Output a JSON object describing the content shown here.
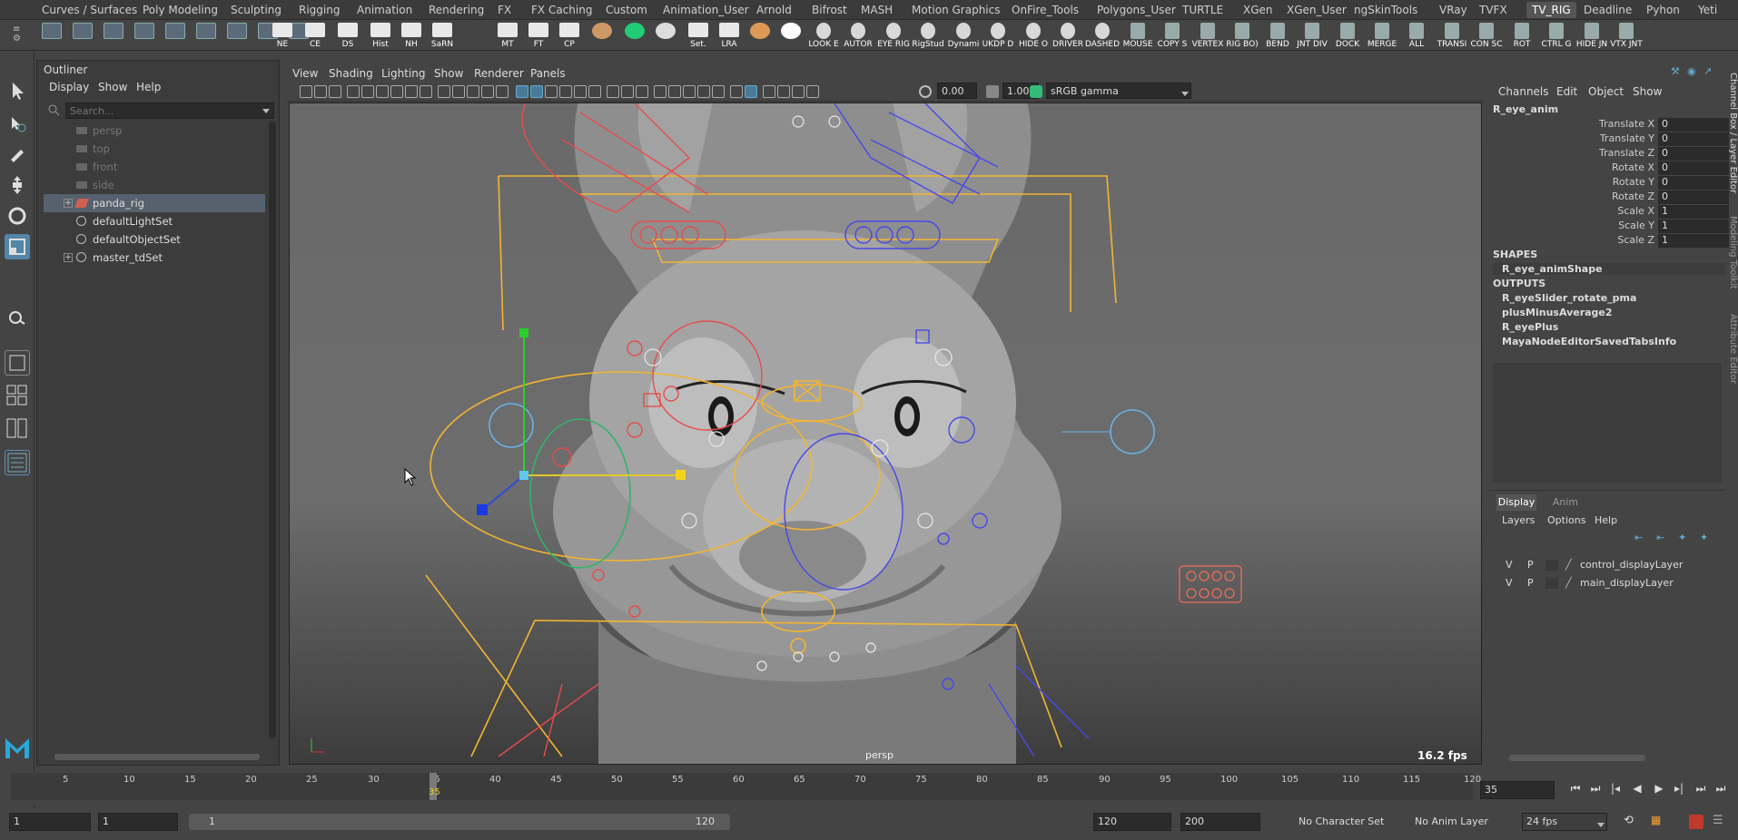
{
  "shelf_tabs": [
    "Curves / Surfaces",
    "Poly Modeling",
    "Sculpting",
    "Rigging",
    "Animation",
    "Rendering",
    "FX",
    "FX Caching",
    "Custom",
    "Animation_User",
    "Arnold",
    "Bifrost",
    "MASH",
    "Motion Graphics",
    "OnFire_Tools",
    "Polygons_User",
    "TURTLE",
    "XGen",
    "XGen_User",
    "ngSkinTools",
    "VRay",
    "TVFX",
    "TV_RIG",
    "Deadline",
    "Pyhon",
    "Yeti"
  ],
  "active_shelf_tab": "TV_RIG",
  "shelf_labels_left": [
    "NE",
    "CE",
    "DS",
    "Hist",
    "NH",
    "SaRN",
    "MT",
    "FT",
    "CP",
    "Set.",
    "LRA"
  ],
  "shelf_labels_right": [
    "LOOK E",
    "AUTOR",
    "EYE RIG",
    "RigStud",
    "Dynami",
    "UKDP D",
    "HIDE O",
    "DRIVER",
    "DASHED",
    "MOUSE",
    "COPY S",
    "VERTEX",
    "RIG BO)",
    "BEND",
    "JNT DIV",
    "DOCK",
    "MERGE",
    "ALL",
    "TRANSI",
    "CON SC",
    "ROT",
    "CTRL G",
    "HIDE JN",
    "VTX JNT"
  ],
  "outliner": {
    "title": "Outliner",
    "menu": [
      "Display",
      "Show",
      "Help"
    ],
    "search_placeholder": "Search...",
    "items": [
      {
        "name": "persp",
        "dim": true,
        "icon": "camera-icon"
      },
      {
        "name": "top",
        "dim": true,
        "icon": "camera-icon"
      },
      {
        "name": "front",
        "dim": true,
        "icon": "camera-icon"
      },
      {
        "name": "side",
        "dim": true,
        "icon": "camera-icon"
      },
      {
        "name": "panda_rig",
        "dim": false,
        "icon": "group-icon",
        "selected": true,
        "expandable": true
      },
      {
        "name": "defaultLightSet",
        "dim": false,
        "icon": "set-icon"
      },
      {
        "name": "defaultObjectSet",
        "dim": false,
        "icon": "set-icon"
      },
      {
        "name": "master_tdSet",
        "dim": false,
        "icon": "set-icon",
        "expandable": true
      }
    ]
  },
  "viewport": {
    "menu": [
      "View",
      "Shading",
      "Lighting",
      "Show",
      "Renderer",
      "Panels"
    ],
    "exposure": "0.00",
    "gamma": "1.00",
    "colorspace": "sRGB gamma",
    "camera_label": "persp",
    "fps": "16.2 fps"
  },
  "channel_box": {
    "menu": [
      "Channels",
      "Edit",
      "Object",
      "Show"
    ],
    "node": "R_eye_anim",
    "attrs": [
      {
        "k": "Translate X",
        "v": "0"
      },
      {
        "k": "Translate Y",
        "v": "0"
      },
      {
        "k": "Translate Z",
        "v": "0"
      },
      {
        "k": "Rotate X",
        "v": "0"
      },
      {
        "k": "Rotate Y",
        "v": "0"
      },
      {
        "k": "Rotate Z",
        "v": "0"
      },
      {
        "k": "Scale X",
        "v": "1"
      },
      {
        "k": "Scale Y",
        "v": "1"
      },
      {
        "k": "Scale Z",
        "v": "1"
      }
    ],
    "shapes_header": "SHAPES",
    "shape": "R_eye_animShape",
    "outputs_header": "OUTPUTS",
    "outputs": [
      "R_eyeSlider_rotate_pma",
      "plusMinusAverage2",
      "R_eyePlus",
      "MayaNodeEditorSavedTabsInfo"
    ],
    "side_tabs": [
      "Channel Box / Layer Editor",
      "Modeling Toolkit",
      "Attribute Editor"
    ]
  },
  "layer_editor": {
    "tabs": [
      "Display",
      "Anim"
    ],
    "menu": [
      "Layers",
      "Options",
      "Help"
    ],
    "layers": [
      {
        "v": "V",
        "p": "P",
        "name": "control_displayLayer"
      },
      {
        "v": "V",
        "p": "P",
        "name": "main_displayLayer"
      }
    ]
  },
  "timeline": {
    "ticks": [
      "5",
      "10",
      "15",
      "20",
      "25",
      "30",
      "35",
      "40",
      "45",
      "50",
      "55",
      "60",
      "65",
      "70",
      "75",
      "80",
      "85",
      "90",
      "95",
      "100",
      "105",
      "110",
      "115",
      "120"
    ],
    "current_frame": "35",
    "current_frame_field": "35"
  },
  "range": {
    "start": "1",
    "playback_start": "1",
    "slider_start": "1",
    "slider_end": "120",
    "playback_end": "120",
    "end": "200",
    "character_set": "No Character Set",
    "anim_layer": "No Anim Layer",
    "fps": "24 fps"
  }
}
